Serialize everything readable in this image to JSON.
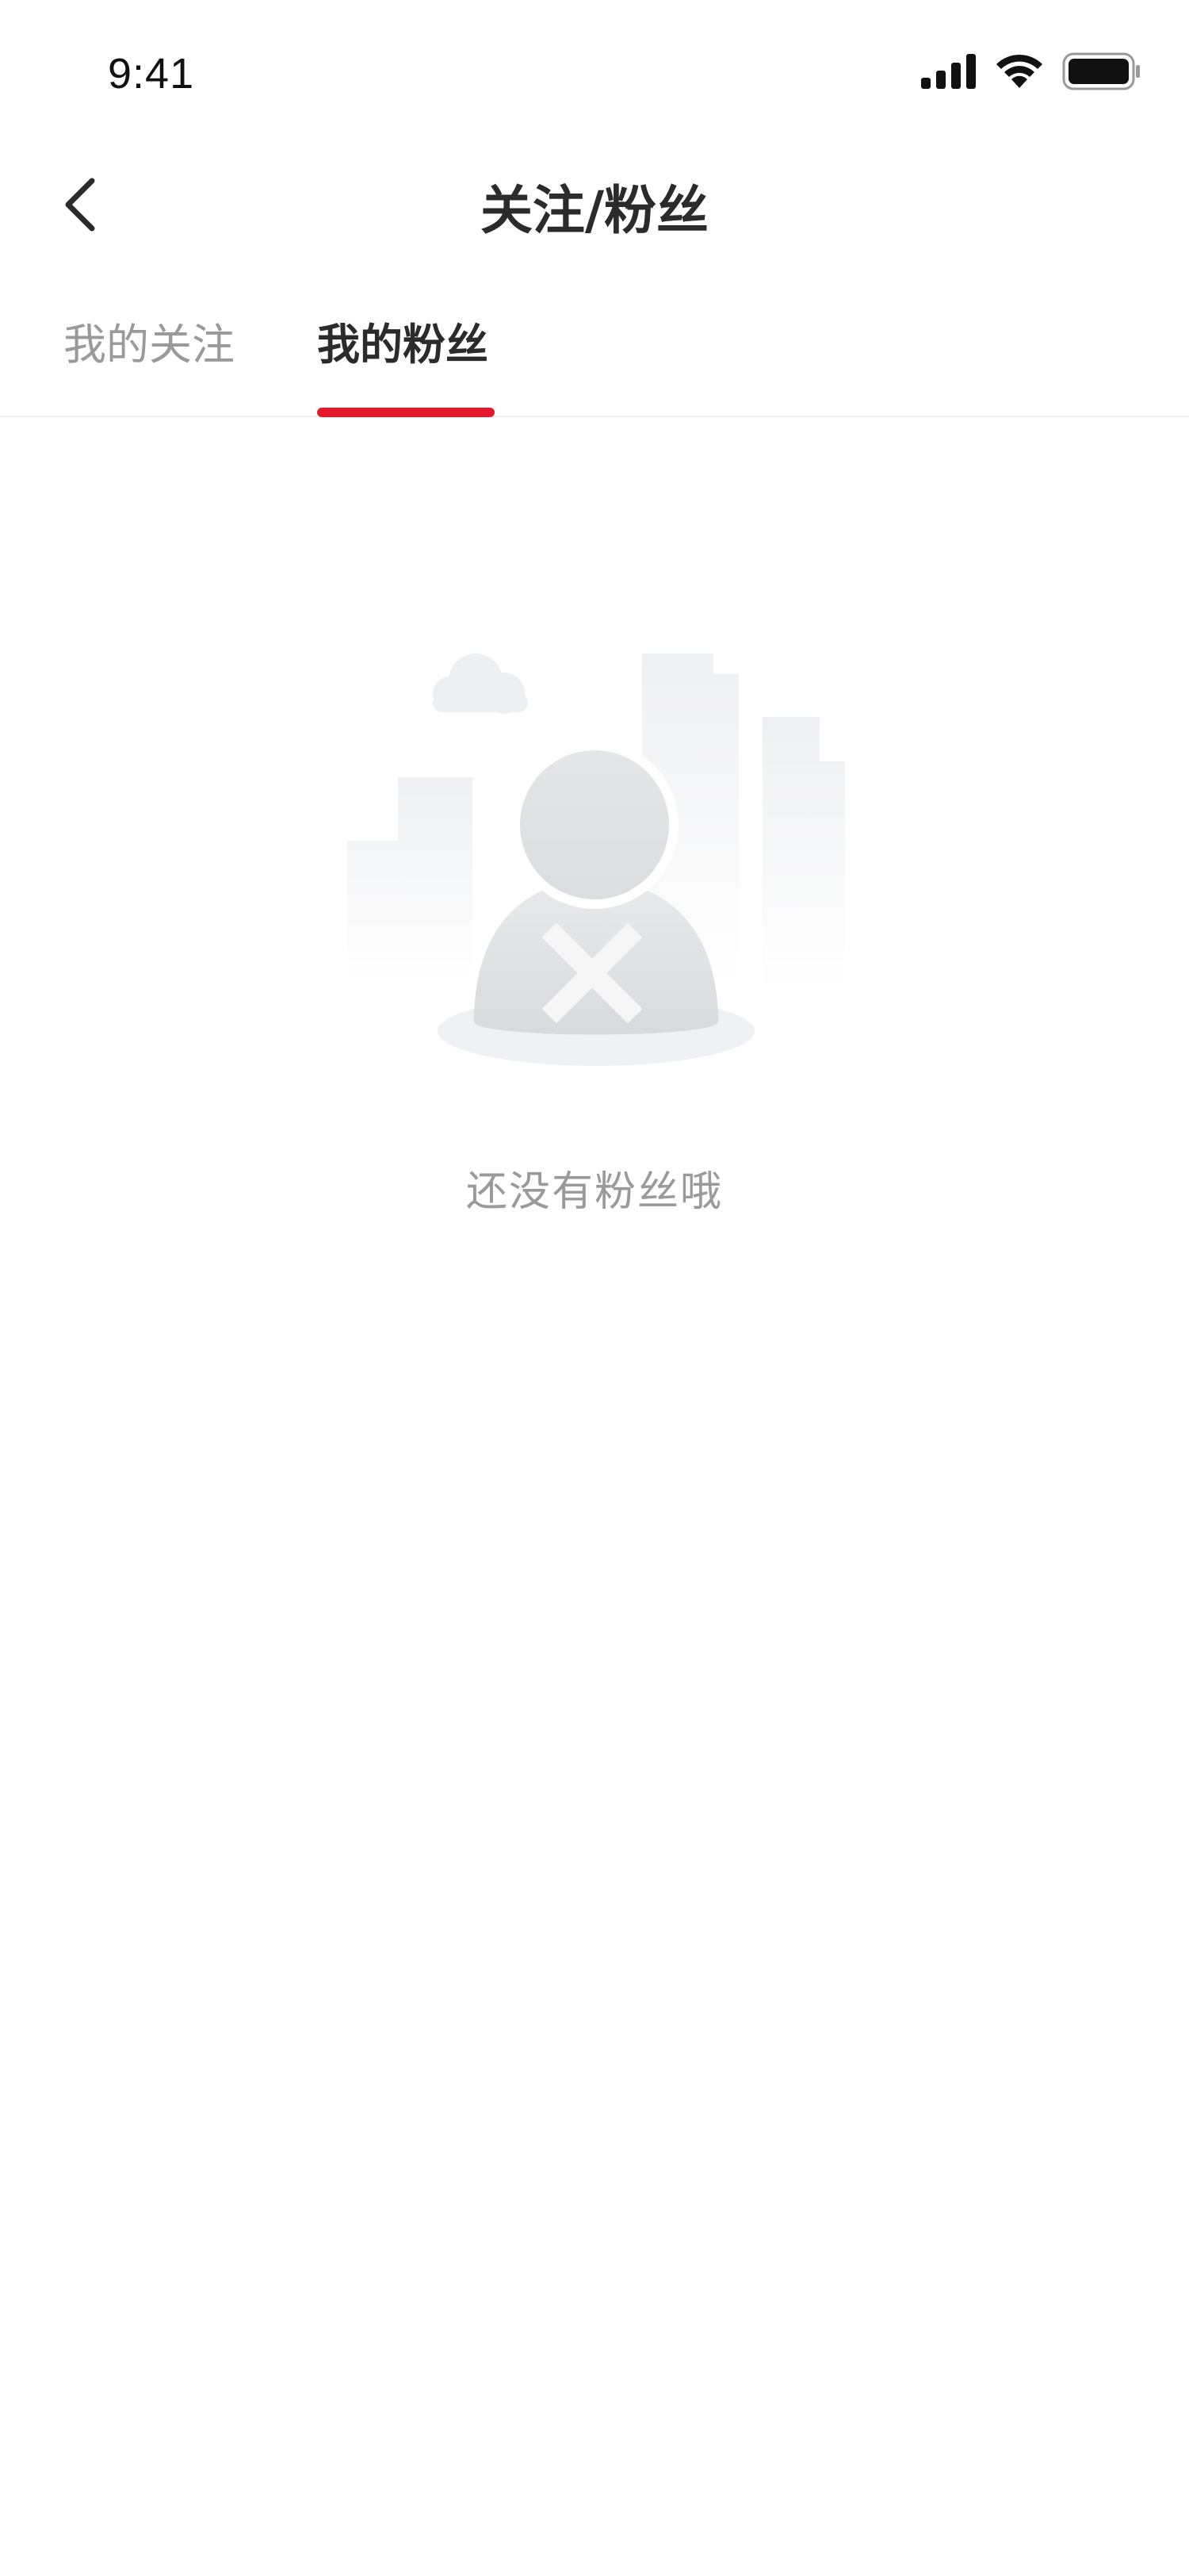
{
  "status_bar": {
    "time": "9:41",
    "icons": [
      "signal-icon",
      "wifi-icon",
      "battery-icon"
    ]
  },
  "nav": {
    "back_icon": "chevron-left-icon",
    "title": "关注/粉丝"
  },
  "tabs": [
    {
      "label": "我的关注",
      "active": false
    },
    {
      "label": "我的粉丝",
      "active": true
    }
  ],
  "empty_state": {
    "illustration": "empty-user-icon",
    "message": "还没有粉丝哦"
  },
  "colors": {
    "accent": "#e31a2d",
    "text_primary": "#2b2b2b",
    "text_secondary": "#9a9a9a",
    "divider": "#efefef",
    "background": "#ffffff"
  }
}
